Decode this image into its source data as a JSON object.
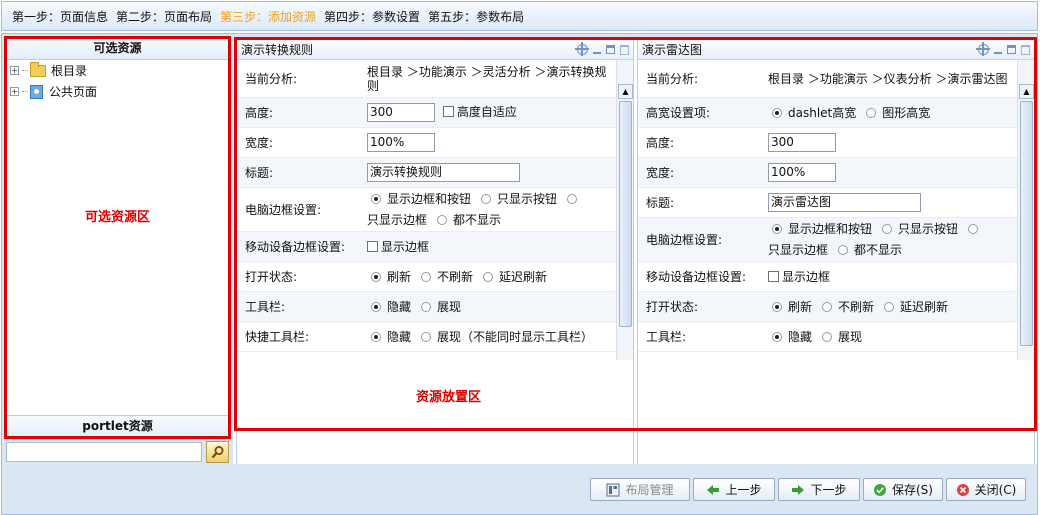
{
  "steps": [
    {
      "label": "第一步：页面信息",
      "active": false
    },
    {
      "label": "第二步：页面布局",
      "active": false
    },
    {
      "label": "第三步：添加资源",
      "active": true
    },
    {
      "label": "第四步：参数设置",
      "active": false
    },
    {
      "label": "第五步：参数布局",
      "active": false
    }
  ],
  "left": {
    "title": "可选资源",
    "tree": [
      {
        "label": "根目录",
        "icon": "folder-icon"
      },
      {
        "label": "公共页面",
        "icon": "page-icon"
      }
    ],
    "zone_label": "可选资源区",
    "footer": "portlet资源",
    "search_value": ""
  },
  "place_zone_label": "资源放置区",
  "portlet1": {
    "title": "演示转换规则",
    "rows": {
      "analysis_label": "当前分析:",
      "analysis_value": "根目录 ＞功能演示 ＞灵活分析 ＞演示转换规则",
      "height_label": "高度:",
      "height_value": "300",
      "height_auto": "高度自适应",
      "width_label": "宽度:",
      "width_value": "100%",
      "title_label": "标题:",
      "title_value": "演示转换规则",
      "pc_border_label": "电脑边框设置:",
      "pc_opt1": "显示边框和按钮",
      "pc_opt2": "只显示按钮",
      "pc_opt3": "只显示边框",
      "pc_opt4": "都不显示",
      "mobile_label": "移动设备边框设置:",
      "mobile_chk": "显示边框",
      "open_label": "打开状态:",
      "open_opt1": "刷新",
      "open_opt2": "不刷新",
      "open_opt3": "延迟刷新",
      "toolbar_label": "工具栏:",
      "toolbar_opt1": "隐藏",
      "toolbar_opt2": "展现",
      "quick_label": "快捷工具栏:",
      "quick_opt1": "隐藏",
      "quick_opt2": "展现（不能同时显示工具栏）"
    }
  },
  "portlet2": {
    "title": "演示雷达图",
    "rows": {
      "analysis_label": "当前分析:",
      "analysis_value": "根目录 ＞功能演示 ＞仪表分析 ＞演示雷达图",
      "hw_label": "高宽设置项:",
      "hw_opt1": "dashlet高宽",
      "hw_opt2": "图形高宽",
      "height_label": "高度:",
      "height_value": "300",
      "width_label": "宽度:",
      "width_value": "100%",
      "title_label": "标题:",
      "title_value": "演示雷达图",
      "pc_border_label": "电脑边框设置:",
      "pc_opt1": "显示边框和按钮",
      "pc_opt2": "只显示按钮",
      "pc_opt3": "只显示边框",
      "pc_opt4": "都不显示",
      "mobile_label": "移动设备边框设置:",
      "mobile_chk": "显示边框",
      "open_label": "打开状态:",
      "open_opt1": "刷新",
      "open_opt2": "不刷新",
      "open_opt3": "延迟刷新",
      "toolbar_label": "工具栏:",
      "toolbar_opt1": "隐藏",
      "toolbar_opt2": "展现"
    }
  },
  "buttons": {
    "layout": "布局管理",
    "prev": "上一步",
    "next": "下一步",
    "save": "保存(S)",
    "close": "关闭(C)"
  },
  "colors": {
    "active_step": "#f0a020",
    "annotation": "#e00000"
  }
}
